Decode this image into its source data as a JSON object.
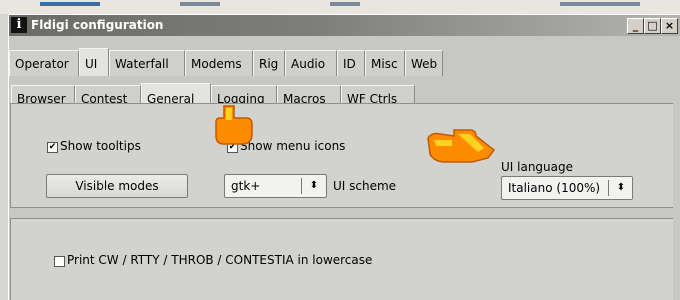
{
  "window": {
    "title": "Fldigi configuration",
    "icon_letter": "i",
    "controls": [
      "_",
      "□",
      "×"
    ]
  },
  "main_tabs": [
    {
      "label": "Operator",
      "active": false
    },
    {
      "label": "UI",
      "active": true
    },
    {
      "label": "Waterfall",
      "active": false
    },
    {
      "label": "Modems",
      "active": false
    },
    {
      "label": "Rig",
      "active": false
    },
    {
      "label": "Audio",
      "active": false
    },
    {
      "label": "ID",
      "active": false
    },
    {
      "label": "Misc",
      "active": false
    },
    {
      "label": "Web",
      "active": false
    }
  ],
  "sub_tabs": [
    {
      "label": "Browser",
      "active": false
    },
    {
      "label": "Contest",
      "active": false
    },
    {
      "label": "General",
      "active": true
    },
    {
      "label": "Logging",
      "active": false
    },
    {
      "label": "Macros",
      "active": false
    },
    {
      "label": "WF Ctrls",
      "active": false
    }
  ],
  "general": {
    "show_tooltips": {
      "label": "Show tooltips",
      "checked": true
    },
    "show_menu_icons": {
      "label": "Show menu icons",
      "checked": true
    },
    "visible_modes_button": "Visible modes",
    "ui_scheme": {
      "value": "gtk+",
      "label": "UI scheme",
      "arrows": "⬍"
    },
    "ui_language": {
      "label": "UI language",
      "value": "Italiano (100%)",
      "arrows": "⬍"
    },
    "print_lowercase": {
      "label": "Print CW / RTTY / THROB / CONTESTIA in lowercase",
      "checked": false
    }
  },
  "cursor_icons": [
    "pointing-hand-icon",
    "pointing-hand-icon"
  ],
  "colors": {
    "cursor_fill": "#ff8c00",
    "cursor_highlight": "#ffd21f"
  }
}
